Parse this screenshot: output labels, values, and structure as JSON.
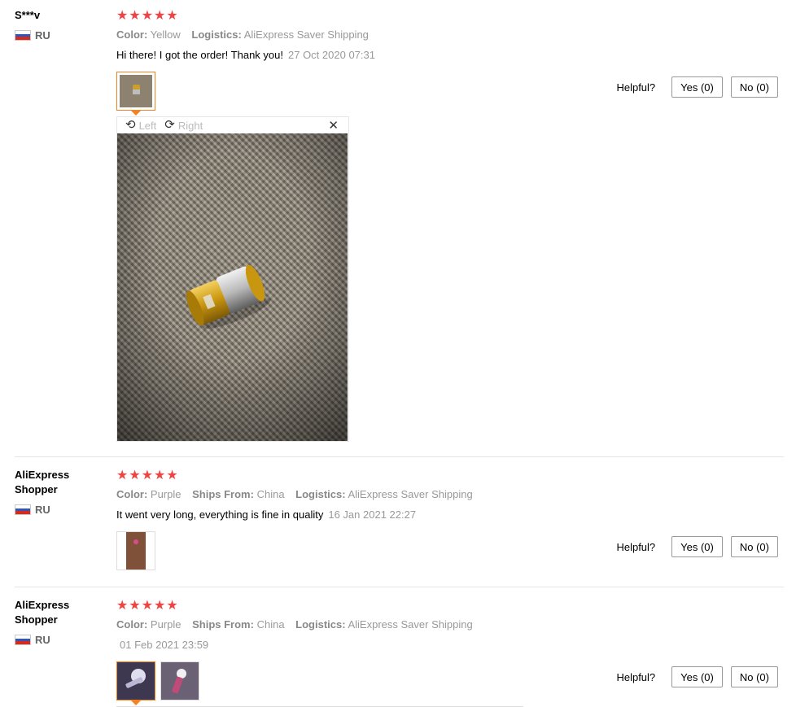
{
  "reviews": [
    {
      "user": "S***v",
      "country": "RU",
      "stars": "★★★★★",
      "attrs": [
        {
          "key": "Color:",
          "value": "Yellow"
        },
        {
          "key": "Logistics:",
          "value": "AliExpress Saver Shipping"
        }
      ],
      "text": "Hi there! I got the order! Thank you!",
      "date": "27 Oct 2020 07:31",
      "helpful": "Helpful?",
      "yes": "Yes (0)",
      "no": "No (0)"
    },
    {
      "user": "AliExpress Shopper",
      "country": "RU",
      "stars": "★★★★★",
      "attrs": [
        {
          "key": "Color:",
          "value": "Purple"
        },
        {
          "key": "Ships From:",
          "value": "China"
        },
        {
          "key": "Logistics:",
          "value": "AliExpress Saver Shipping"
        }
      ],
      "text": "It went very long, everything is fine in quality",
      "date": "16 Jan 2021 22:27",
      "helpful": "Helpful?",
      "yes": "Yes (0)",
      "no": "No (0)"
    },
    {
      "user": "AliExpress Shopper",
      "country": "RU",
      "stars": "★★★★★",
      "attrs": [
        {
          "key": "Color:",
          "value": "Purple"
        },
        {
          "key": "Ships From:",
          "value": "China"
        },
        {
          "key": "Logistics:",
          "value": "AliExpress Saver Shipping"
        }
      ],
      "text": "",
      "date": "01 Feb 2021 23:59",
      "helpful": "Helpful?",
      "yes": "Yes (0)",
      "no": "No (0)"
    }
  ],
  "viewer": {
    "left_label": "Left",
    "right_label": "Right",
    "rotate_left_icon": "rotate-left-icon",
    "rotate_right_icon": "rotate-right-icon",
    "close_icon": "close-icon"
  },
  "colors": {
    "star": "#ee4444",
    "active_border": "#f5821f"
  }
}
